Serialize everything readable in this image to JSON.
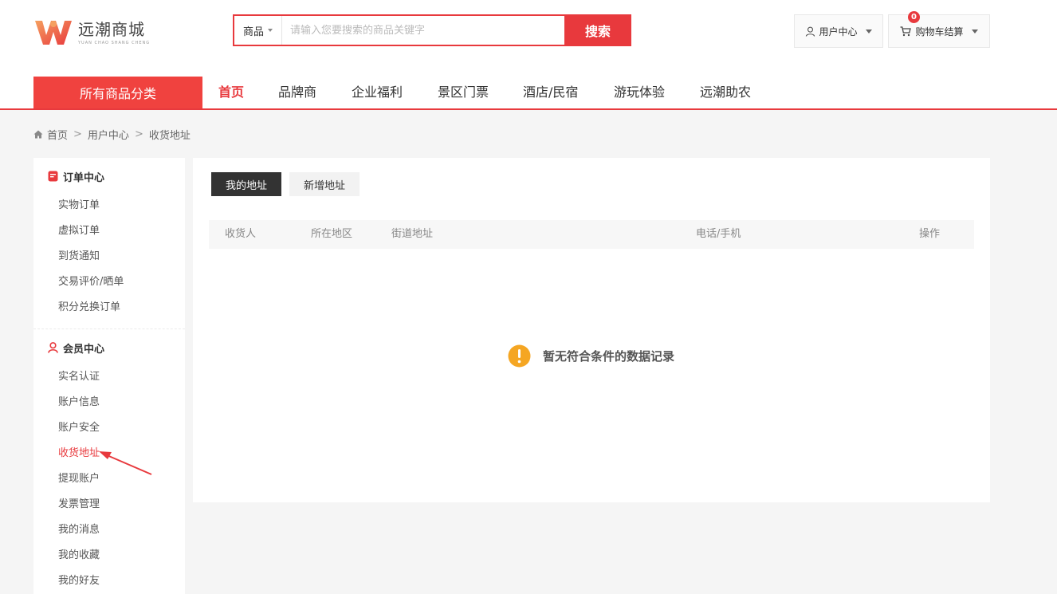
{
  "brand": {
    "name": "远潮商城",
    "tagline": "YUAN CHAO SHANG CHENG"
  },
  "search": {
    "type": "商品",
    "placeholder": "请输入您要搜索的商品关键字",
    "button": "搜索"
  },
  "header": {
    "user_center": "用户中心",
    "cart": "购物车结算",
    "cart_count": "0"
  },
  "nav": {
    "all_categories": "所有商品分类",
    "items": [
      "首页",
      "品牌商",
      "企业福利",
      "景区门票",
      "酒店/民宿",
      "游玩体验",
      "远潮助农"
    ]
  },
  "breadcrumb": [
    "首页",
    "用户中心",
    "收货地址"
  ],
  "breadcrumb_sep": ">",
  "sidebar": {
    "order_title": "订单中心",
    "order_items": [
      "实物订单",
      "虚拟订单",
      "到货通知",
      "交易评价/晒单",
      "积分兑换订单"
    ],
    "member_title": "会员中心",
    "member_items": [
      "实名认证",
      "账户信息",
      "账户安全",
      "收货地址",
      "提现账户",
      "发票管理",
      "我的消息",
      "我的收藏",
      "我的好友"
    ]
  },
  "tabs": {
    "mine": "我的地址",
    "add": "新增地址"
  },
  "table": {
    "headers": [
      "收货人",
      "所在地区",
      "街道地址",
      "电话/手机",
      "操作"
    ]
  },
  "empty_message": "暂无符合条件的数据记录",
  "colors": {
    "accent": "#e8393d",
    "warning": "#f5a623"
  }
}
